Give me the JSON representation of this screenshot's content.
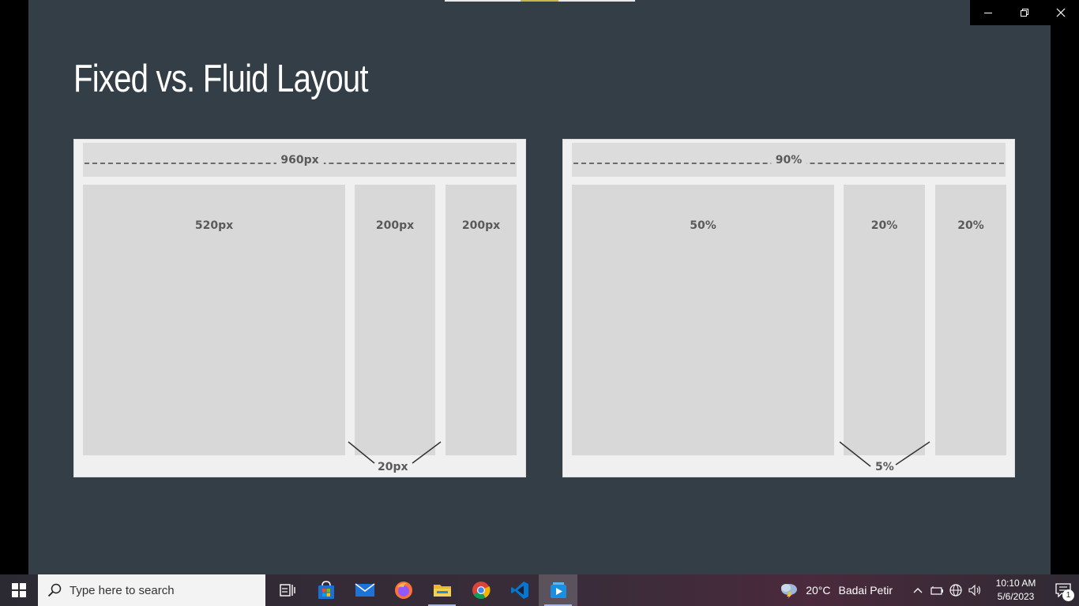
{
  "slide": {
    "title": "Fixed vs. Fluid Layout"
  },
  "diagrams": {
    "fixed": {
      "total_label": "960px",
      "columns": [
        "520px",
        "200px",
        "200px"
      ],
      "gutter_label": "20px"
    },
    "fluid": {
      "total_label": "90%",
      "columns": [
        "50%",
        "20%",
        "20%"
      ],
      "gutter_label": "5%"
    }
  },
  "window_controls": {
    "minimize_icon": "minimize-icon",
    "restore_icon": "restore-icon",
    "close_icon": "close-icon"
  },
  "taskbar": {
    "search_placeholder": "Type here to search",
    "apps": [
      "task-view",
      "microsoft-store",
      "mail",
      "firefox",
      "file-explorer",
      "chrome",
      "vscode",
      "media-player"
    ],
    "weather": {
      "temperature": "20°C",
      "condition": "Badai Petir"
    },
    "clock": {
      "time": "10:10 AM",
      "date": "5/6/2023"
    },
    "notification_count": "1"
  }
}
